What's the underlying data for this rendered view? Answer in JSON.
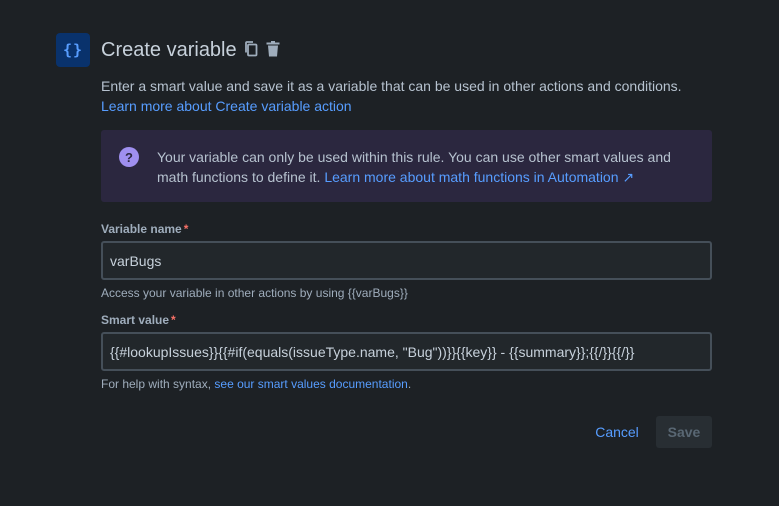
{
  "header": {
    "icon_text": "{}",
    "icon": "curly-braces-icon",
    "title": "Create variable",
    "actions": [
      "copy-icon",
      "trash-icon"
    ]
  },
  "description": {
    "text": "Enter a smart value and save it as a variable that can be used in other actions and conditions.",
    "link": "Learn more about Create variable action"
  },
  "info": {
    "icon": "question-circle-icon",
    "icon_text": "?",
    "text": "Your variable can only be used within this rule. You can use other smart values and math functions to define it.",
    "link": "Learn more about math functions in Automation ↗"
  },
  "variable_name": {
    "label": "Variable name",
    "required_mark": "*",
    "value": "varBugs",
    "help": "Access your variable in other actions by using {{varBugs}}"
  },
  "smart_value": {
    "label": "Smart value",
    "required_mark": "*",
    "value": "{{#lookupIssues}}{{#if(equals(issueType.name, \"Bug\"))}}{{key}} - {{summary}};{{/}}{{/}}",
    "help_prefix": "For help with syntax, ",
    "help_link": "see our smart values documentation",
    "help_suffix": "."
  },
  "buttons": {
    "cancel": "Cancel",
    "save": "Save"
  },
  "colors": {
    "background": "#1d2125",
    "link": "#579dff",
    "info_panel": "#2b273f",
    "info_icon": "#9f8fef",
    "required": "#f87168"
  }
}
